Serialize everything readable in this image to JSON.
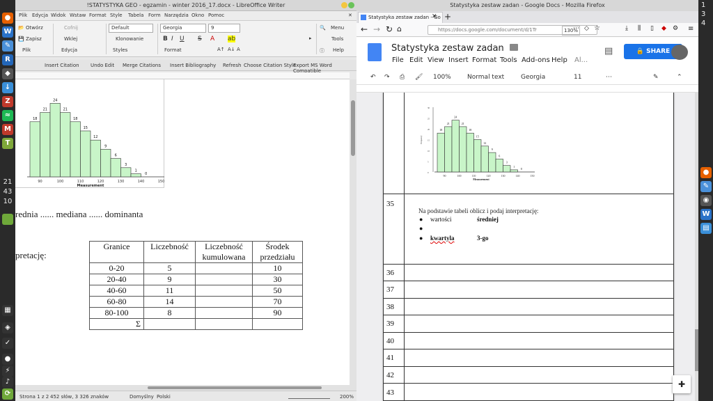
{
  "left_dock": {
    "clock": [
      "21",
      "43",
      "10"
    ]
  },
  "right_dock": {
    "clock": [
      "1",
      "3",
      "4"
    ]
  },
  "libreoffice": {
    "title": "!STATYSTYKA GEO - egzamin - winter 2016_17.docx - LibreOffice Writer",
    "menu": [
      "Plik",
      "Edycja",
      "Widok",
      "Wstaw",
      "Format",
      "Style",
      "Tabela",
      "Form",
      "Narzędzia",
      "Okno",
      "Pomoc"
    ],
    "toolbar": {
      "open": "Otwórz",
      "save": "Zapisz",
      "file": "Plik",
      "undo": "Cofnij",
      "paste": "Wklej",
      "edit": "Edycja",
      "style_value": "Default",
      "cloning": "Klonowanie",
      "styles": "Styles",
      "font_value": "Georgia",
      "size_value": "9",
      "format": "Format",
      "menu": "Menu",
      "tools": "Tools",
      "help": "Help"
    },
    "zotero": [
      "Insert Citation",
      "Undo Edit",
      "Merge Citations",
      "Insert Bibliography",
      "Refresh",
      "Choose Citation Style",
      "Export MS Word Compatible"
    ],
    "doc": {
      "summary_line": "rednia ...... mediana ...... dominanta",
      "interpret_label": "pretację:",
      "table_headers": [
        "Granice",
        "Liczebność",
        "Liczebność kumulowana",
        "Środek przedziału"
      ],
      "table_rows": [
        [
          "0-20",
          "5",
          "",
          "10"
        ],
        [
          "20-40",
          "9",
          "",
          "30"
        ],
        [
          "40-60",
          "11",
          "",
          "50"
        ],
        [
          "60-80",
          "14",
          "",
          "70"
        ],
        [
          "80-100",
          "8",
          "",
          "90"
        ],
        [
          "Σ",
          "",
          "",
          ""
        ]
      ]
    },
    "status": {
      "page": "Strona 1 z 2",
      "words": "452 słów, 3 326 znaków",
      "style": "Domyślny",
      "lang": "Polski",
      "zoom": "200%"
    }
  },
  "histogram": {
    "xlabel": "Measurement",
    "ylabel": "Frequency",
    "xticks": [
      "90",
      "100",
      "110",
      "120",
      "130",
      "140",
      "150"
    ],
    "yticks": [
      "0",
      "5",
      "10",
      "15",
      "20",
      "25",
      "30"
    ]
  },
  "chart_data": {
    "type": "bar",
    "categories": [
      "85-90",
      "90-95",
      "95-100",
      "100-105",
      "105-110",
      "110-115",
      "115-120",
      "120-125",
      "125-130",
      "130-135",
      "135-140",
      "140-145"
    ],
    "values": [
      18,
      21,
      24,
      21,
      18,
      15,
      12,
      9,
      6,
      3,
      1,
      0
    ],
    "xlabel": "Measurement",
    "ylabel": "Frequency",
    "ylim": [
      0,
      30
    ],
    "grid": false
  },
  "firefox": {
    "title": "Statystyka zestaw zadan - Google Docs - Mozilla Firefox",
    "tab_title": "Statystyka zestaw zadan - Go",
    "url": "https://docs.google.com/document/d/1Tr",
    "zoom": "130%"
  },
  "gdocs": {
    "title": "Statystyka zestaw zadan",
    "menu": [
      "File",
      "Edit",
      "View",
      "Insert",
      "Format",
      "Tools",
      "Add-ons",
      "Help",
      "Al..."
    ],
    "share": "SHARE",
    "toolbar": {
      "zoom": "100%",
      "style": "Normal text",
      "font": "Georgia",
      "size": "11"
    },
    "q35": {
      "num": "35",
      "intro": "Na podstawie tabeli oblicz i podaj interpretację:",
      "b1a": "wartości",
      "b1b": "średniej",
      "b3a": "kwartyla",
      "b3b": "3-go"
    },
    "rows": [
      "36",
      "37",
      "38",
      "39",
      "40",
      "41",
      "42",
      "43"
    ]
  }
}
